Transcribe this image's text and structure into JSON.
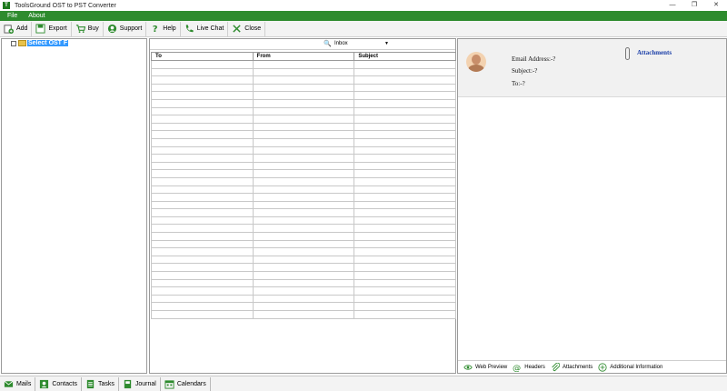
{
  "window": {
    "title": "ToolsGround OST to PST Converter",
    "minimize": "—",
    "restore": "❐",
    "close": "✕"
  },
  "menu": [
    "File",
    "About"
  ],
  "toolbar": [
    {
      "label": "Add",
      "icon": "add-icon"
    },
    {
      "label": "Export",
      "icon": "export-icon"
    },
    {
      "label": "Buy",
      "icon": "cart-icon"
    },
    {
      "label": "Support",
      "icon": "support-icon"
    },
    {
      "label": "Help",
      "icon": "help-icon"
    },
    {
      "label": "Live Chat",
      "icon": "phone-icon"
    },
    {
      "label": "Close",
      "icon": "close-icon"
    }
  ],
  "tree": {
    "label": "Select OST F"
  },
  "mail_list": {
    "folder": "Inbox",
    "columns": [
      "To",
      "From",
      "Subject"
    ]
  },
  "preview": {
    "email_address": "Email Address:-?",
    "subject": "Subject:-?",
    "to": "To:-?",
    "attachments_link": "Attachments",
    "tabs": [
      "Web Preview",
      "Headers",
      "Attachments",
      "Additional Information"
    ]
  },
  "bottom_tabs": [
    "Mails",
    "Contacts",
    "Tasks",
    "Journal",
    "Calendars"
  ],
  "colors": {
    "accent": "#2e8b2e",
    "selection": "#3399ff",
    "link": "#1a3ea8"
  }
}
